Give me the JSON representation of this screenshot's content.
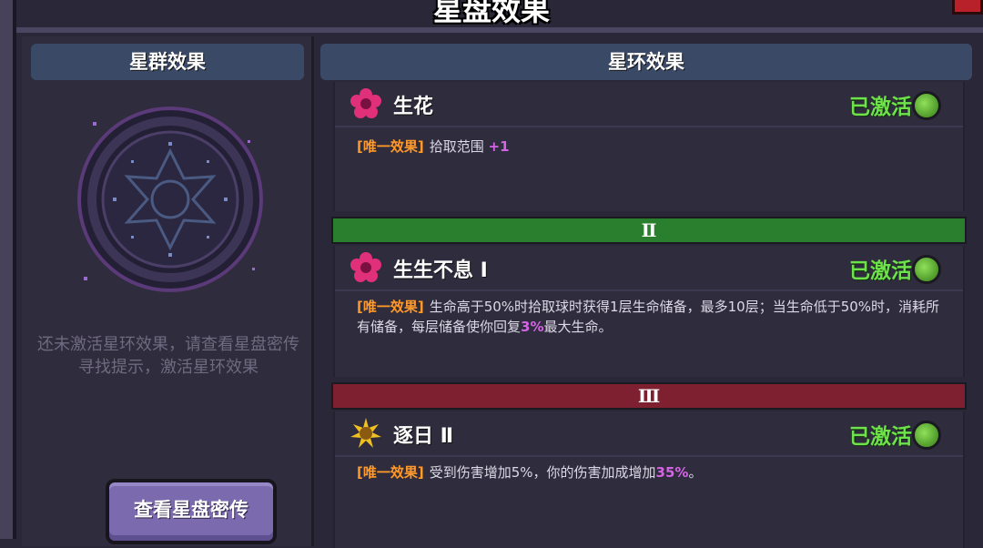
{
  "window": {
    "title": "星盘效果"
  },
  "left": {
    "header": "星群效果",
    "hint": "还未激活星环效果，请查看星盘密传寻找提示，激活星环效果",
    "button_label": "查看星盘密传"
  },
  "right": {
    "header": "星环效果",
    "cards": [
      {
        "name": "生花",
        "icon": "flower-icon",
        "status": "已激活",
        "tag": "[唯一效果]",
        "desc_parts": [
          "拾取范围 ",
          "+1",
          ""
        ]
      },
      {
        "name": "生生不息 Ⅰ",
        "icon": "flower-icon",
        "status": "已激活",
        "tag": "[唯一效果]",
        "desc_parts": [
          "生命高于50%时拾取球时获得1层生命储备，最多10层；当生命低于50%时，消耗所有储备，每层储备使你回复",
          "3%",
          "最大生命。"
        ]
      },
      {
        "name": "逐日 Ⅱ",
        "icon": "sun-icon",
        "status": "已激活",
        "tag": "[唯一效果]",
        "desc_parts": [
          "受到伤害增加5%，你的伤害加成增加",
          "35%",
          "。"
        ]
      }
    ],
    "tiers": [
      "Ⅱ",
      "Ⅲ"
    ]
  },
  "colors": {
    "active_green": "#6ee24a",
    "tag_orange": "#ff9a2a",
    "highlight_purple": "#d563e6",
    "tier2_green": "#2a7f2e",
    "tier3_red": "#7e2030"
  }
}
